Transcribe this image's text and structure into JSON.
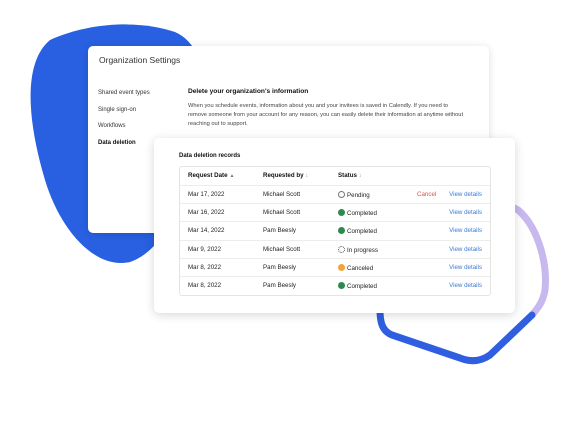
{
  "colors": {
    "blob": "#2860e1",
    "ring_purple": "#c7b8ee",
    "ring_blue": "#2f5fe0",
    "link": "#3b7bd6",
    "cancel": "#d9534f",
    "completed": "#2d8a4e",
    "canceled": "#f0a53a"
  },
  "settings": {
    "title": "Organization Settings",
    "sidebar": [
      "Shared event types",
      "Single sign-on",
      "Workflows",
      "Data deletion"
    ],
    "active_item": "Data deletion",
    "section_title": "Delete your organization's information",
    "section_desc": "When you schedule events, information about you and your invitees is saved in Calendly. If you need to remove someone from your account for any reason, you can easily delete their information at anytime without reaching out to support."
  },
  "records": {
    "title": "Data deletion records",
    "headers": {
      "date": "Request Date",
      "requested_by": "Requested by",
      "status": "Status"
    },
    "sort_icons": {
      "date": "▲",
      "requested_by": "↕",
      "status": "↕"
    },
    "cancel_label": "Cancel",
    "view_label": "View details",
    "rows": [
      {
        "date": "Mar 17, 2022",
        "by": "Michael Scott",
        "status": "Pending",
        "icon": "pending-icon",
        "cancel": true
      },
      {
        "date": "Mar 16, 2022",
        "by": "Michael Scott",
        "status": "Completed",
        "icon": "completed-icon",
        "cancel": false
      },
      {
        "date": "Mar 14, 2022",
        "by": "Pam Beesly",
        "status": "Completed",
        "icon": "completed-icon",
        "cancel": false
      },
      {
        "date": "Mar 9, 2022",
        "by": "Michael Scott",
        "status": "In progress",
        "icon": "in-progress-icon",
        "cancel": false
      },
      {
        "date": "Mar 8, 2022",
        "by": "Pam Beesly",
        "status": "Canceled",
        "icon": "canceled-icon",
        "cancel": false
      },
      {
        "date": "Mar 8, 2022",
        "by": "Pam Beesly",
        "status": "Completed",
        "icon": "completed-icon",
        "cancel": false
      }
    ]
  }
}
